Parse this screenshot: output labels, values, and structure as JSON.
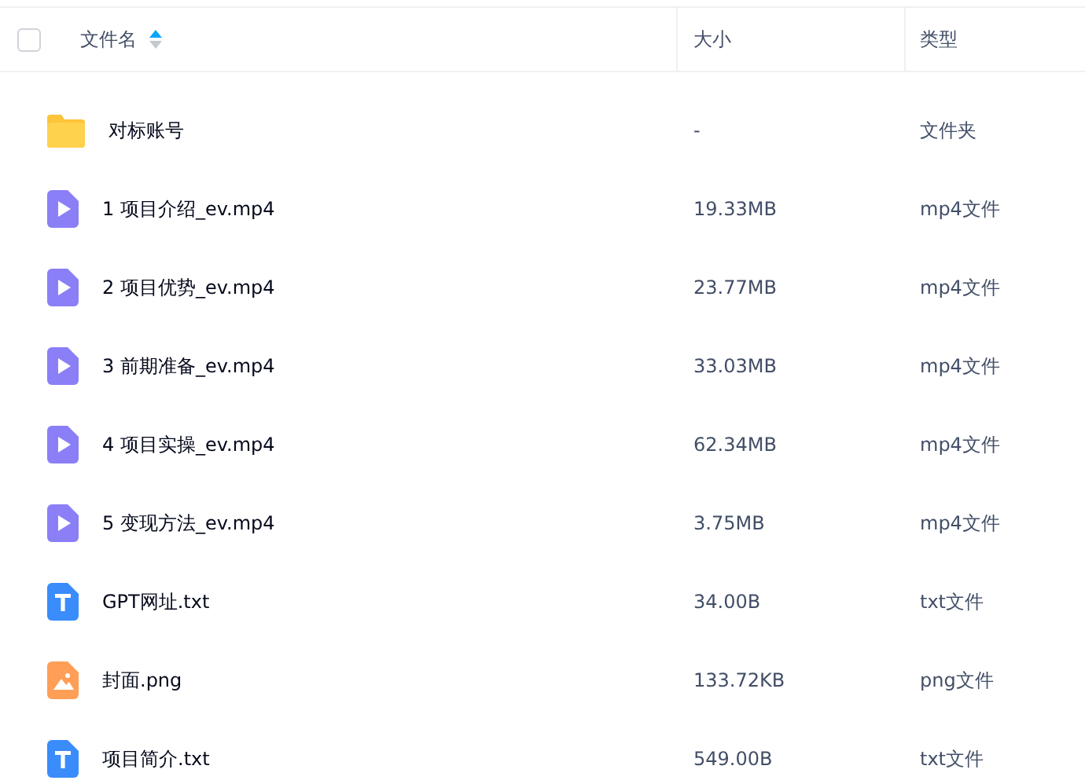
{
  "table": {
    "select_all": {
      "checked": false
    },
    "columns": [
      {
        "label": "文件名",
        "sort_ascending": true
      },
      {
        "label": "大小"
      },
      {
        "label": "类型"
      }
    ],
    "rows": [
      {
        "kind": "folder",
        "name": "对标账号",
        "size": "-",
        "type": "文件夹"
      },
      {
        "kind": "video",
        "name": "1 项目介绍_ev.mp4",
        "size": "19.33MB",
        "type": "mp4文件"
      },
      {
        "kind": "video",
        "name": "2 项目优势_ev.mp4",
        "size": "23.77MB",
        "type": "mp4文件"
      },
      {
        "kind": "video",
        "name": "3 前期准备_ev.mp4",
        "size": "33.03MB",
        "type": "mp4文件"
      },
      {
        "kind": "video",
        "name": "4 项目实操_ev.mp4",
        "size": "62.34MB",
        "type": "mp4文件"
      },
      {
        "kind": "video",
        "name": "5 变现方法_ev.mp4",
        "size": "3.75MB",
        "type": "mp4文件"
      },
      {
        "kind": "text",
        "name": "GPT网址.txt",
        "size": "34.00B",
        "type": "txt文件"
      },
      {
        "kind": "image",
        "name": "封面.png",
        "size": "133.72KB",
        "type": "png文件"
      },
      {
        "kind": "text",
        "name": "项目简介.txt",
        "size": "549.00B",
        "type": "txt文件"
      }
    ]
  }
}
